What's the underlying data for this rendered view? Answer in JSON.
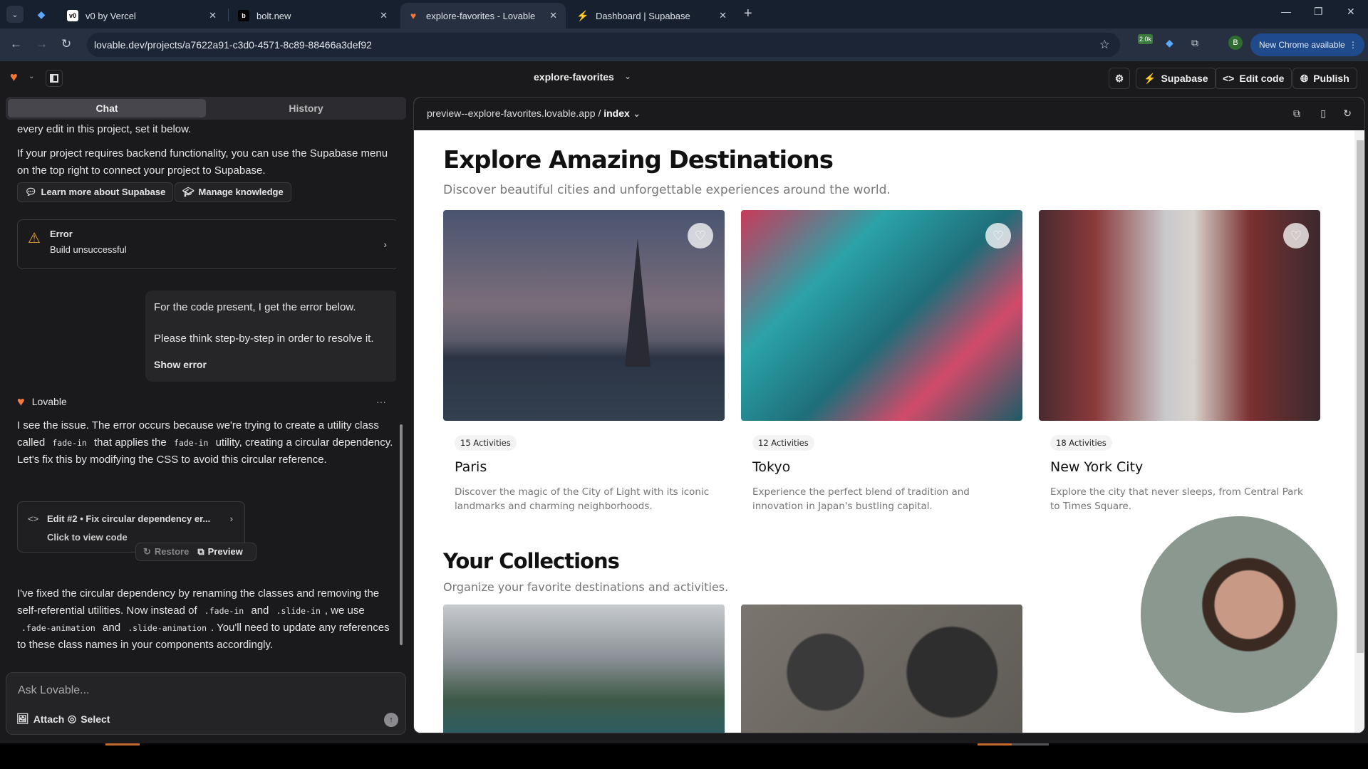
{
  "browser": {
    "tabs": [
      {
        "label": "v0 by Vercel",
        "icon": "v0-icon"
      },
      {
        "label": "bolt.new",
        "icon": "bolt-icon"
      },
      {
        "label": "explore-favorites - Lovable",
        "icon": "lovable-heart-icon",
        "active": true
      },
      {
        "label": "Dashboard | Supabase",
        "icon": "supabase-icon"
      }
    ],
    "url": "lovable.dev/projects/a7622a91-c3d0-4571-8c89-88466a3def92",
    "extension_badge": "2.0k",
    "profile_initial": "B",
    "update_label": "New Chrome available"
  },
  "app": {
    "project_name": "explore-favorites",
    "toolbar": {
      "supabase_label": "Supabase",
      "edit_code_label": "Edit code",
      "publish_label": "Publish"
    },
    "accent": "#3ecf8e"
  },
  "sidebar": {
    "tabs": [
      {
        "label": "Chat",
        "active": true
      },
      {
        "label": "History",
        "active": false
      }
    ],
    "messages": {
      "cut_line": "every edit in this project, set it below.",
      "supabase_info": "If your project requires backend functionality, you can use the Supabase menu on the top right to connect your project to Supabase.",
      "learn_more_label": "Learn more about Supabase",
      "manage_knowledge_label": "Manage knowledge",
      "error_title": "Error",
      "error_subtitle": "Build unsuccessful",
      "user_line1": "For the code present, I get the error below.",
      "user_line2": "Please think step-by-step in order to resolve it.",
      "show_error_label": "Show error",
      "bot_name": "Lovable",
      "bot_reply_1": {
        "a": "I see the issue. The error occurs because we're trying to create a utility class called",
        "code1": "fade-in",
        "b": "that applies the",
        "code2": "fade-in",
        "c": "utility, creating a circular dependency. Let's fix this by modifying the CSS to avoid this circular reference."
      },
      "edit_title": "Edit #2 • Fix circular dependency er...",
      "edit_sub": "Click to view code",
      "restore_label": "Restore",
      "preview_label": "Preview",
      "bot_reply_2": {
        "a": "I've fixed the circular dependency by renaming the classes and removing the self-referential utilities. Now instead of",
        "code1": ".fade-in",
        "b": "and",
        "code2": ".slide-in",
        "c": ", we use",
        "code3": ".fade-animation",
        "d": "and",
        "code4": ".slide-animation",
        "e": ". You'll need to update any references to these class names in your components accordingly."
      }
    },
    "composer": {
      "placeholder": "Ask Lovable...",
      "attach_label": "Attach",
      "select_label": "Select"
    }
  },
  "preview": {
    "url_prefix": "preview--explore-favorites.lovable.app /",
    "route": "index",
    "page": {
      "title": "Explore Amazing Destinations",
      "subtitle": "Discover beautiful cities and unforgettable experiences around the world.",
      "destinations": [
        {
          "activities": "15 Activities",
          "name": "Paris",
          "desc": "Discover the magic of the City of Light with its iconic landmarks and charming neighborhoods."
        },
        {
          "activities": "12 Activities",
          "name": "Tokyo",
          "desc": "Experience the perfect blend of tradition and innovation in Japan's bustling capital."
        },
        {
          "activities": "18 Activities",
          "name": "New York City",
          "desc": "Explore the city that never sleeps, from Central Park to Times Square."
        }
      ],
      "collections_title": "Your Collections",
      "collections_subtitle": "Organize your favorite destinations and activities."
    }
  }
}
